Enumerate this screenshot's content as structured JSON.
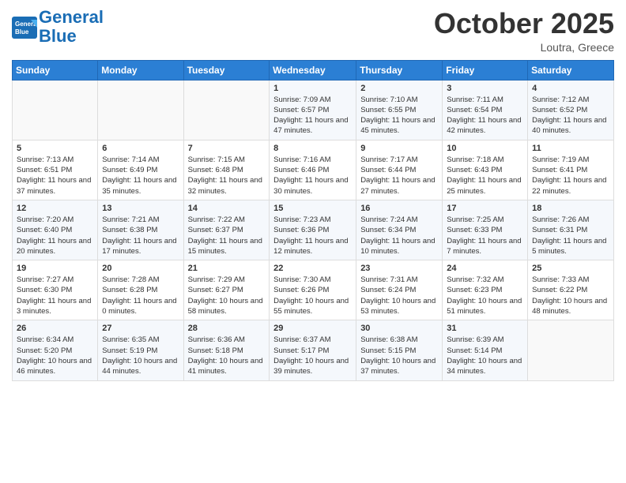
{
  "header": {
    "logo_line1": "General",
    "logo_line2": "Blue",
    "month_title": "October 2025",
    "subtitle": "Loutra, Greece"
  },
  "weekdays": [
    "Sunday",
    "Monday",
    "Tuesday",
    "Wednesday",
    "Thursday",
    "Friday",
    "Saturday"
  ],
  "weeks": [
    [
      {
        "day": "",
        "info": ""
      },
      {
        "day": "",
        "info": ""
      },
      {
        "day": "",
        "info": ""
      },
      {
        "day": "1",
        "info": "Sunrise: 7:09 AM\nSunset: 6:57 PM\nDaylight: 11 hours and 47 minutes."
      },
      {
        "day": "2",
        "info": "Sunrise: 7:10 AM\nSunset: 6:55 PM\nDaylight: 11 hours and 45 minutes."
      },
      {
        "day": "3",
        "info": "Sunrise: 7:11 AM\nSunset: 6:54 PM\nDaylight: 11 hours and 42 minutes."
      },
      {
        "day": "4",
        "info": "Sunrise: 7:12 AM\nSunset: 6:52 PM\nDaylight: 11 hours and 40 minutes."
      }
    ],
    [
      {
        "day": "5",
        "info": "Sunrise: 7:13 AM\nSunset: 6:51 PM\nDaylight: 11 hours and 37 minutes."
      },
      {
        "day": "6",
        "info": "Sunrise: 7:14 AM\nSunset: 6:49 PM\nDaylight: 11 hours and 35 minutes."
      },
      {
        "day": "7",
        "info": "Sunrise: 7:15 AM\nSunset: 6:48 PM\nDaylight: 11 hours and 32 minutes."
      },
      {
        "day": "8",
        "info": "Sunrise: 7:16 AM\nSunset: 6:46 PM\nDaylight: 11 hours and 30 minutes."
      },
      {
        "day": "9",
        "info": "Sunrise: 7:17 AM\nSunset: 6:44 PM\nDaylight: 11 hours and 27 minutes."
      },
      {
        "day": "10",
        "info": "Sunrise: 7:18 AM\nSunset: 6:43 PM\nDaylight: 11 hours and 25 minutes."
      },
      {
        "day": "11",
        "info": "Sunrise: 7:19 AM\nSunset: 6:41 PM\nDaylight: 11 hours and 22 minutes."
      }
    ],
    [
      {
        "day": "12",
        "info": "Sunrise: 7:20 AM\nSunset: 6:40 PM\nDaylight: 11 hours and 20 minutes."
      },
      {
        "day": "13",
        "info": "Sunrise: 7:21 AM\nSunset: 6:38 PM\nDaylight: 11 hours and 17 minutes."
      },
      {
        "day": "14",
        "info": "Sunrise: 7:22 AM\nSunset: 6:37 PM\nDaylight: 11 hours and 15 minutes."
      },
      {
        "day": "15",
        "info": "Sunrise: 7:23 AM\nSunset: 6:36 PM\nDaylight: 11 hours and 12 minutes."
      },
      {
        "day": "16",
        "info": "Sunrise: 7:24 AM\nSunset: 6:34 PM\nDaylight: 11 hours and 10 minutes."
      },
      {
        "day": "17",
        "info": "Sunrise: 7:25 AM\nSunset: 6:33 PM\nDaylight: 11 hours and 7 minutes."
      },
      {
        "day": "18",
        "info": "Sunrise: 7:26 AM\nSunset: 6:31 PM\nDaylight: 11 hours and 5 minutes."
      }
    ],
    [
      {
        "day": "19",
        "info": "Sunrise: 7:27 AM\nSunset: 6:30 PM\nDaylight: 11 hours and 3 minutes."
      },
      {
        "day": "20",
        "info": "Sunrise: 7:28 AM\nSunset: 6:28 PM\nDaylight: 11 hours and 0 minutes."
      },
      {
        "day": "21",
        "info": "Sunrise: 7:29 AM\nSunset: 6:27 PM\nDaylight: 10 hours and 58 minutes."
      },
      {
        "day": "22",
        "info": "Sunrise: 7:30 AM\nSunset: 6:26 PM\nDaylight: 10 hours and 55 minutes."
      },
      {
        "day": "23",
        "info": "Sunrise: 7:31 AM\nSunset: 6:24 PM\nDaylight: 10 hours and 53 minutes."
      },
      {
        "day": "24",
        "info": "Sunrise: 7:32 AM\nSunset: 6:23 PM\nDaylight: 10 hours and 51 minutes."
      },
      {
        "day": "25",
        "info": "Sunrise: 7:33 AM\nSunset: 6:22 PM\nDaylight: 10 hours and 48 minutes."
      }
    ],
    [
      {
        "day": "26",
        "info": "Sunrise: 6:34 AM\nSunset: 5:20 PM\nDaylight: 10 hours and 46 minutes."
      },
      {
        "day": "27",
        "info": "Sunrise: 6:35 AM\nSunset: 5:19 PM\nDaylight: 10 hours and 44 minutes."
      },
      {
        "day": "28",
        "info": "Sunrise: 6:36 AM\nSunset: 5:18 PM\nDaylight: 10 hours and 41 minutes."
      },
      {
        "day": "29",
        "info": "Sunrise: 6:37 AM\nSunset: 5:17 PM\nDaylight: 10 hours and 39 minutes."
      },
      {
        "day": "30",
        "info": "Sunrise: 6:38 AM\nSunset: 5:15 PM\nDaylight: 10 hours and 37 minutes."
      },
      {
        "day": "31",
        "info": "Sunrise: 6:39 AM\nSunset: 5:14 PM\nDaylight: 10 hours and 34 minutes."
      },
      {
        "day": "",
        "info": ""
      }
    ]
  ]
}
